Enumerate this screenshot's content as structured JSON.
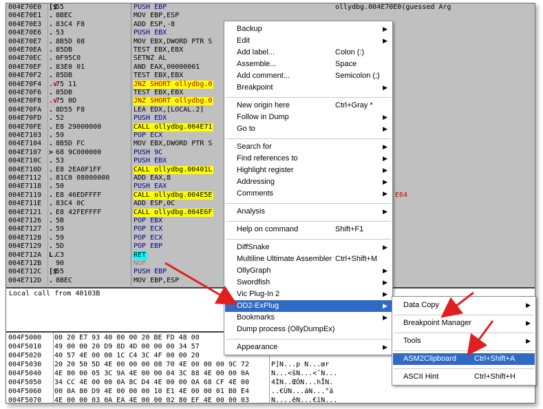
{
  "code": {
    "rows": [
      {
        "addr": "004E70E0",
        "mark": "[$",
        "bytes": "55",
        "asm": "PUSH EBP",
        "kind": "push",
        "extra": "ollydbg.004E70E0(guessed Arg"
      },
      {
        "addr": "004E70E1",
        "mark": ".",
        "bytes": "8BEC",
        "asm": "MOV EBP,ESP",
        "kind": "plain",
        "extra": ""
      },
      {
        "addr": "004E70E3",
        "mark": ".",
        "bytes": "83C4 F8",
        "asm": "ADD ESP,-8",
        "kind": "plain",
        "extra": ""
      },
      {
        "addr": "004E70E6",
        "mark": ".",
        "bytes": "53",
        "asm": "PUSH EBX",
        "kind": "push",
        "extra": ""
      },
      {
        "addr": "004E70E7",
        "mark": ".",
        "bytes": "8B5D 08",
        "asm": "MOV EBX,DWORD PTR S",
        "kind": "plain",
        "extra": ""
      },
      {
        "addr": "004E70EA",
        "mark": ".",
        "bytes": "85DB",
        "asm": "TEST EBX,EBX",
        "kind": "plain",
        "extra": ""
      },
      {
        "addr": "004E70EC",
        "mark": ".",
        "bytes": "0F95C0",
        "asm": "SETNZ AL",
        "kind": "plain",
        "extra": ""
      },
      {
        "addr": "004E70EF",
        "mark": ".",
        "bytes": "83E0 01",
        "asm": "AND EAX,00000001",
        "kind": "plain",
        "extra": ""
      },
      {
        "addr": "004E70F2",
        "mark": ".",
        "bytes": "85DB",
        "asm": "TEST EBX,EBX",
        "kind": "plain",
        "extra": ""
      },
      {
        "addr": "004E70F4",
        "mark": ".v",
        "bytes": "75 11",
        "asm": "JNZ SHORT ollydbg.0",
        "kind": "jcc",
        "extra": ""
      },
      {
        "addr": "004E70F6",
        "mark": ".",
        "bytes": "85DB",
        "asm": "TEST EBX,EBX",
        "kind": "plain",
        "extra": ""
      },
      {
        "addr": "004E70F8",
        "mark": ".v",
        "bytes": "75 0D",
        "asm": "JNZ SHORT ollydbg.0",
        "kind": "jcc",
        "extra": ""
      },
      {
        "addr": "004E70FA",
        "mark": ".",
        "bytes": "8D55 F8",
        "asm": "LEA EDX,[LOCAL.2]",
        "kind": "plain",
        "extra": ""
      },
      {
        "addr": "004E70FD",
        "mark": ".",
        "bytes": "52",
        "asm": "PUSH EDX",
        "kind": "push",
        "extra": ""
      },
      {
        "addr": "004E70FE",
        "mark": ".",
        "bytes": "E8 29000000",
        "asm": "CALL ollydbg.004E71",
        "kind": "call",
        "extra": ""
      },
      {
        "addr": "004E7103",
        "mark": ".",
        "bytes": "59",
        "asm": "POP ECX",
        "kind": "push",
        "extra": ""
      },
      {
        "addr": "004E7104",
        "mark": ".",
        "bytes": "8B5D FC",
        "asm": "MOV EBX,DWORD PTR S",
        "kind": "plain",
        "extra": ""
      },
      {
        "addr": "004E7107",
        "mark": ">",
        "bytes": "68 9C000000",
        "asm": "PUSH 9C",
        "kind": "push",
        "extra": ""
      },
      {
        "addr": "004E710C",
        "mark": ".",
        "bytes": "53",
        "asm": "PUSH EBX",
        "kind": "push",
        "extra": ""
      },
      {
        "addr": "004E710D",
        "mark": ".",
        "bytes": "E8 2EA0F1FF",
        "asm": "CALL ollydbg.00401L",
        "kind": "call",
        "extra": ""
      },
      {
        "addr": "004E7112",
        "mark": ".",
        "bytes": "81C0 08000000",
        "asm": "ADD EAX,8",
        "kind": "plain",
        "extra": ""
      },
      {
        "addr": "004E7118",
        "mark": ".",
        "bytes": "50",
        "asm": "PUSH EAX",
        "kind": "push",
        "extra": ""
      },
      {
        "addr": "004E7119",
        "mark": ".",
        "bytes": "E8 46EDFFFF",
        "asm": "CALL ollydbg.004E5E",
        "kind": "call",
        "extra": "E64"
      },
      {
        "addr": "004E711E",
        "mark": ".",
        "bytes": "83C4 0C",
        "asm": "ADD ESP,0C",
        "kind": "plain",
        "extra": ""
      },
      {
        "addr": "004E7121",
        "mark": ".",
        "bytes": "E8 42FEFFFF",
        "asm": "CALL ollydbg.004E6F",
        "kind": "call",
        "extra": ""
      },
      {
        "addr": "004E7126",
        "mark": ".",
        "bytes": "5B",
        "asm": "POP EBX",
        "kind": "push",
        "extra": ""
      },
      {
        "addr": "004E7127",
        "mark": ".",
        "bytes": "59",
        "asm": "POP ECX",
        "kind": "push",
        "extra": ""
      },
      {
        "addr": "004E7128",
        "mark": ".",
        "bytes": "59",
        "asm": "POP ECX",
        "kind": "push",
        "extra": ""
      },
      {
        "addr": "004E7129",
        "mark": ".",
        "bytes": "5D",
        "asm": "POP EBP",
        "kind": "push",
        "extra": ""
      },
      {
        "addr": "004E712A",
        "mark": "L.",
        "bytes": "C3",
        "asm": "RET",
        "kind": "ret",
        "extra": ""
      },
      {
        "addr": "004E712B",
        "mark": "",
        "bytes": "90",
        "asm": "NOP",
        "kind": "nop",
        "extra": ""
      },
      {
        "addr": "004E712C",
        "mark": "[$",
        "bytes": "55",
        "asm": "PUSH EBP",
        "kind": "push",
        "extra": ""
      },
      {
        "addr": "004E712D",
        "mark": ".",
        "bytes": "8BEC",
        "asm": "MOV EBP,ESP",
        "kind": "plain",
        "extra": ""
      }
    ]
  },
  "info": {
    "text": "Local call from 40103B"
  },
  "dump": {
    "rows": [
      {
        "addr": "004F5000",
        "hex": "00 20 E7 93 40 00 00 20 BE FD 48 00",
        "ascii": ""
      },
      {
        "addr": "004F5010",
        "hex": "49 00 00 20 D9 8D 4D 00 00 00 34 57",
        "ascii": ""
      },
      {
        "addr": "004F5020",
        "hex": "40 57 4E 00 00 1C C4 3C 4F 00 00 20",
        "ascii": ""
      },
      {
        "addr": "004F5030",
        "hex": "20 20 50 5D 4E 00 00 00 08 70 4E 00 00 00 9C 72",
        "ascii": "P]N...p N...œr"
      },
      {
        "addr": "004F5040",
        "hex": "4E 00 00 05 3C 9A 4E 00 00 04 3C 88 4E 00 00 0A",
        "ascii": "N...<šN...<ˆN..."
      },
      {
        "addr": "004F5050",
        "hex": "34 CC 4E 00 00 0A 8C D4 4E 00 00 0A 68 CF 4E 00",
        "ascii": "4ÌN..ŒÔN...hÏN."
      },
      {
        "addr": "004F5060",
        "hex": "00 0A 80 D9 4E 00 00 00 10 E1 4E 00 00 01 B0 E4",
        "ascii": "..€ÙN...áN...°ä"
      },
      {
        "addr": "004F5070",
        "hex": "4E 00 00 03 0A EA 4E 00 00 02 80 EF 4E 00 00 03",
        "ascii": "N....êN...€ïN..."
      }
    ]
  },
  "main_menu": {
    "items": [
      {
        "type": "item",
        "label": "Backup",
        "shortcut": "",
        "submenu": true
      },
      {
        "type": "item",
        "label": "Edit",
        "shortcut": "",
        "submenu": true
      },
      {
        "type": "item",
        "label": "Add label...",
        "shortcut": "Colon (:)",
        "submenu": false
      },
      {
        "type": "item",
        "label": "Assemble...",
        "shortcut": "Space",
        "submenu": false
      },
      {
        "type": "item",
        "label": "Add comment...",
        "shortcut": "Semicolon (;)",
        "submenu": false
      },
      {
        "type": "item",
        "label": "Breakpoint",
        "shortcut": "",
        "submenu": true
      },
      {
        "type": "sep"
      },
      {
        "type": "item",
        "label": "New origin here",
        "shortcut": "Ctrl+Gray *",
        "submenu": false
      },
      {
        "type": "item",
        "label": "Follow in Dump",
        "shortcut": "",
        "submenu": true
      },
      {
        "type": "item",
        "label": "Go to",
        "shortcut": "",
        "submenu": true
      },
      {
        "type": "sep"
      },
      {
        "type": "item",
        "label": "Search for",
        "shortcut": "",
        "submenu": true
      },
      {
        "type": "item",
        "label": "Find references to",
        "shortcut": "",
        "submenu": true
      },
      {
        "type": "item",
        "label": "Highlight register",
        "shortcut": "",
        "submenu": true
      },
      {
        "type": "item",
        "label": "Addressing",
        "shortcut": "",
        "submenu": true
      },
      {
        "type": "item",
        "label": "Comments",
        "shortcut": "",
        "submenu": true
      },
      {
        "type": "sep"
      },
      {
        "type": "item",
        "label": "Analysis",
        "shortcut": "",
        "submenu": true
      },
      {
        "type": "sep"
      },
      {
        "type": "item",
        "label": "Help on command",
        "shortcut": "Shift+F1",
        "submenu": false
      },
      {
        "type": "sep"
      },
      {
        "type": "item",
        "label": "DiffSnake",
        "shortcut": "",
        "submenu": true
      },
      {
        "type": "item",
        "label": "Multiline Ultimate Assembler",
        "shortcut": "Ctrl+Shift+M",
        "submenu": false
      },
      {
        "type": "item",
        "label": "OllyGraph",
        "shortcut": "",
        "submenu": true
      },
      {
        "type": "item",
        "label": "Swordfish",
        "shortcut": "",
        "submenu": true
      },
      {
        "type": "item",
        "label": "Vic Plug-In 2",
        "shortcut": "",
        "submenu": true
      },
      {
        "type": "item",
        "label": "OD2-ExPlug",
        "shortcut": "",
        "submenu": true,
        "selected": true
      },
      {
        "type": "item",
        "label": "Bookmarks",
        "shortcut": "",
        "submenu": true
      },
      {
        "type": "item",
        "label": "Dump process (OllyDumpEx)",
        "shortcut": "",
        "submenu": false
      },
      {
        "type": "sep"
      },
      {
        "type": "item",
        "label": "Appearance",
        "shortcut": "",
        "submenu": true
      }
    ]
  },
  "sub_menu": {
    "items": [
      {
        "type": "item",
        "label": "Data Copy",
        "shortcut": "",
        "submenu": true
      },
      {
        "type": "sep"
      },
      {
        "type": "item",
        "label": "Breakpoint Manager",
        "shortcut": "",
        "submenu": true
      },
      {
        "type": "sep"
      },
      {
        "type": "item",
        "label": "Tools",
        "shortcut": "",
        "submenu": true
      },
      {
        "type": "sep"
      },
      {
        "type": "item",
        "label": "ASM2Clipboard",
        "shortcut": "Ctrl+Shift+A",
        "submenu": false,
        "selected": true
      },
      {
        "type": "sep"
      },
      {
        "type": "item",
        "label": "ASCII Hint",
        "shortcut": "Ctrl+Shift+H",
        "submenu": false
      }
    ]
  },
  "colors": {
    "selection": "#316ac5",
    "annotation_arrow": "#e02020",
    "call_highlight": "#ffff00",
    "ret_highlight": "#00ffff"
  },
  "icons": {
    "submenu_arrow": "submenu-arrow-icon",
    "annotation_arrows": "red-pointer-arrow-icon"
  }
}
